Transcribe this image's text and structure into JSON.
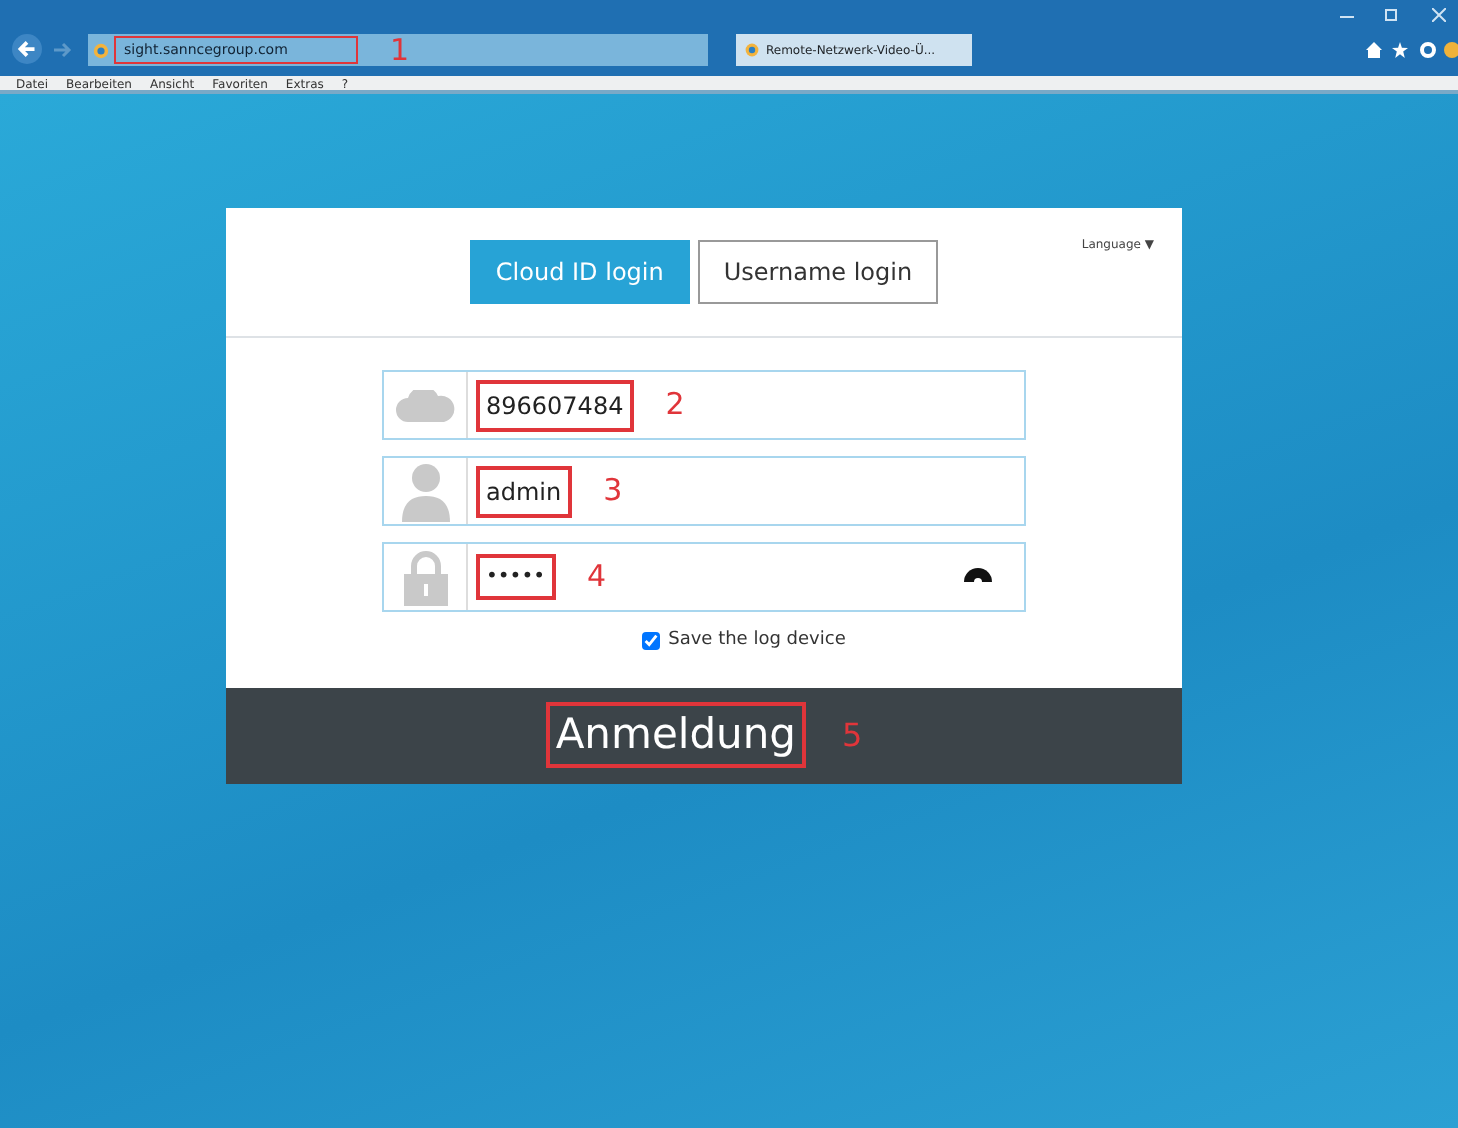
{
  "browser": {
    "address": "sight.sanncegroup.com",
    "address_annotation": "1",
    "tab_title": "Remote-Netzwerk-Video-Ü...",
    "menu": [
      "Datei",
      "Bearbeiten",
      "Ansicht",
      "Favoriten",
      "Extras",
      "?"
    ]
  },
  "login": {
    "tabs": [
      {
        "label": "Cloud ID login",
        "selected": true
      },
      {
        "label": "Username login",
        "selected": false
      }
    ],
    "language": "Language ▼",
    "fields": [
      {
        "kind": "cloud",
        "value": "896607484",
        "annotation": "2"
      },
      {
        "kind": "user",
        "value": "admin",
        "annotation": "3"
      },
      {
        "kind": "password",
        "value": "•••••",
        "annotation": "4"
      }
    ],
    "save_device": {
      "label": "Save the log device",
      "checked": true
    },
    "submit": {
      "label": "Anmeldung",
      "annotation": "5"
    }
  }
}
